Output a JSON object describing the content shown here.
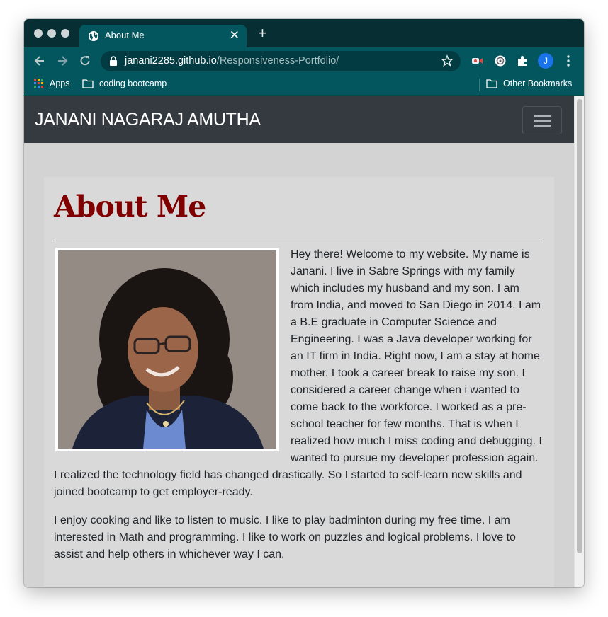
{
  "browser": {
    "tab_title": "About Me",
    "url_host": "janani2285.github.io",
    "url_path": "/Responsiveness-Portfolio/",
    "profile_initial": "J",
    "bookmarks": {
      "apps": "Apps",
      "folder1": "coding bootcamp",
      "other": "Other Bookmarks"
    },
    "colors": {
      "frame": "#072e33",
      "toolbar": "#03565e",
      "omnibox": "#023c42"
    }
  },
  "site": {
    "brand": "JANANI NAGARAJ AMUTHA",
    "heading": "About Me",
    "paragraphs": [
      "Hey there! Welcome to my website. My name is Janani. I live in Sabre Springs with my family which includes my husband and my son. I am from India, and moved to San Diego in 2014. I am a B.E graduate in Computer Science and Engineering. I was a Java developer working for an IT firm in India. Right now, I am a stay at home mother. I took a career break to raise my son. I considered a career change when i wanted to come back to the workforce. I worked as a pre-school teacher for few months. That is when I realized how much I miss coding and debugging. I wanted to pursue my developer profession again. I realized the technology field has changed drastically. So I started to self-learn new skills and joined bootcamp to get employer-ready.",
      "I enjoy cooking and like to listen to music. I like to play badminton during my free time. I am interested in Math and programming. I like to work on puzzles and logical problems. I love to assist and help others in whichever way I can."
    ],
    "colors": {
      "navbar": "#343a40",
      "heading": "#800000",
      "background": "#d3d3d3"
    }
  }
}
